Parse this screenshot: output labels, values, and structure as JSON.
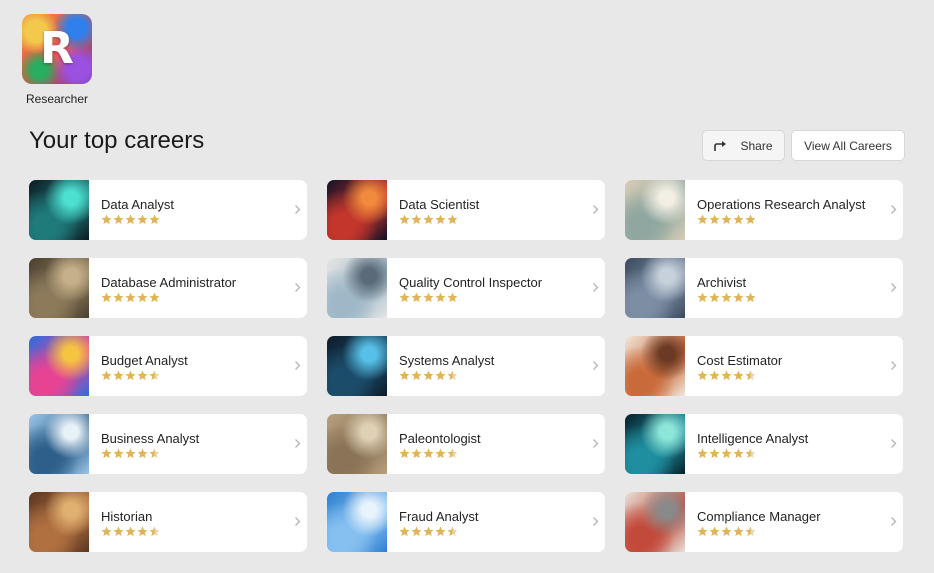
{
  "profile": {
    "badge_letter": "R",
    "label": "Researcher"
  },
  "heading": "Your top careers",
  "actions": {
    "share_label": "Share",
    "view_all_label": "View All Careers"
  },
  "colors": {
    "star": "#e0b45a",
    "star_empty": "#e6d3a8",
    "chevron": "#b5b5b5"
  },
  "careers": [
    {
      "title": "Data Analyst",
      "rating": 5,
      "image": "dashboard-screens-image",
      "palette": [
        "#0c1a22",
        "#1f7a7a",
        "#4de0d0"
      ]
    },
    {
      "title": "Data Scientist",
      "rating": 5,
      "image": "data-lights-image",
      "palette": [
        "#101028",
        "#c4362b",
        "#f08a3c"
      ]
    },
    {
      "title": "Operations Research Analyst",
      "rating": 5,
      "image": "desk-papers-image",
      "palette": [
        "#d9cdb6",
        "#8fa7a0",
        "#f4efe4"
      ]
    },
    {
      "title": "Database Administrator",
      "rating": 5,
      "image": "hands-keyboard-image",
      "palette": [
        "#4a3f2f",
        "#8c7a5b",
        "#c6b089"
      ]
    },
    {
      "title": "Quality Control Inspector",
      "rating": 5,
      "image": "clipboard-check-image",
      "palette": [
        "#e6e6e6",
        "#9fb8c8",
        "#5a6a78"
      ]
    },
    {
      "title": "Archivist",
      "rating": 5,
      "image": "file-cabinets-image",
      "palette": [
        "#3a4a5e",
        "#7d8ea4",
        "#c7d1dc"
      ]
    },
    {
      "title": "Budget Analyst",
      "rating": 4.5,
      "image": "pie-chart-image",
      "palette": [
        "#2d6cdf",
        "#e84393",
        "#f5c542"
      ]
    },
    {
      "title": "Systems Analyst",
      "rating": 4.5,
      "image": "tablet-network-image",
      "palette": [
        "#0d1b2a",
        "#1b4d6b",
        "#58c0e8"
      ]
    },
    {
      "title": "Cost Estimator",
      "rating": 4.5,
      "image": "calculator-notes-image",
      "palette": [
        "#f2e7db",
        "#c96a3a",
        "#6b3a24"
      ]
    },
    {
      "title": "Business Analyst",
      "rating": 4.5,
      "image": "business-charts-image",
      "palette": [
        "#9cc6e8",
        "#2d5f8a",
        "#e8f1f8"
      ]
    },
    {
      "title": "Paleontologist",
      "rating": 4.5,
      "image": "fossil-rock-image",
      "palette": [
        "#b8a07e",
        "#8a7457",
        "#e0d1b6"
      ]
    },
    {
      "title": "Intelligence Analyst",
      "rating": 4.5,
      "image": "globe-network-image",
      "palette": [
        "#06202a",
        "#1f8fa0",
        "#8ee6d8"
      ]
    },
    {
      "title": "Historian",
      "rating": 4.5,
      "image": "magnifier-books-image",
      "palette": [
        "#5a3520",
        "#b07040",
        "#e0b070"
      ]
    },
    {
      "title": "Fraud Analyst",
      "rating": 4.5,
      "image": "magnifier-chart-image",
      "palette": [
        "#2d7fd0",
        "#86c0f0",
        "#e8f3fc"
      ]
    },
    {
      "title": "Compliance Manager",
      "rating": 4.5,
      "image": "meeting-table-image",
      "palette": [
        "#e8e2da",
        "#c24a3a",
        "#8a8a8a"
      ]
    }
  ]
}
